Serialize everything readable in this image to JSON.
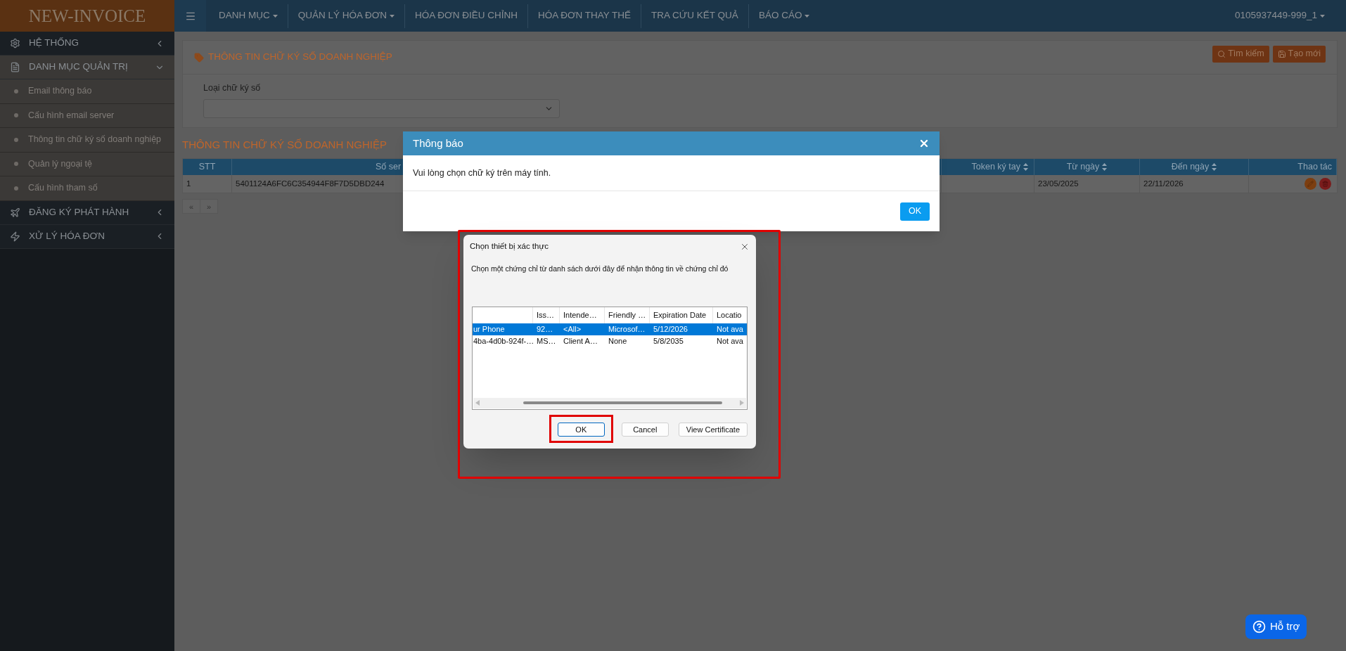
{
  "app": {
    "logo": "NEW-INVOICE"
  },
  "top_nav": {
    "items": [
      {
        "label": "DANH MỤC",
        "dropdown": true
      },
      {
        "label": "QUẢN LÝ HÓA ĐƠN",
        "dropdown": true
      },
      {
        "label": "HÓA ĐƠN ĐIỀU CHỈNH",
        "dropdown": false
      },
      {
        "label": "HÓA ĐƠN THAY THẾ",
        "dropdown": false
      },
      {
        "label": "TRA CỨU KẾT QUẢ",
        "dropdown": false
      },
      {
        "label": "BÁO CÁO",
        "dropdown": true
      }
    ],
    "user": {
      "label": "0105937449-999_1",
      "dropdown": true
    }
  },
  "sidebar": {
    "items": [
      {
        "label": "HỆ THỐNG",
        "expanded": false
      },
      {
        "label": "DANH MỤC QUẢN TRỊ",
        "expanded": true,
        "children": [
          {
            "label": "Email thông báo"
          },
          {
            "label": "Cấu hình email server"
          },
          {
            "label": "Thông tin chữ ký số doanh nghiệp"
          },
          {
            "label": "Quản lý ngoại tệ"
          },
          {
            "label": "Cấu hình tham số"
          }
        ]
      },
      {
        "label": "ĐĂNG KÝ PHÁT HÀNH",
        "expanded": false
      },
      {
        "label": "XỬ LÝ HÓA ĐƠN",
        "expanded": false
      }
    ]
  },
  "panel": {
    "title": "THÔNG TIN CHỮ KÝ SỐ DOANH NGHIỆP",
    "buttons": [
      "Tìm kiếm",
      "Tạo mới"
    ],
    "field_label": "Loại chữ ký số"
  },
  "table": {
    "title": "THÔNG TIN CHỮ KÝ SỐ DOANH NGHIỆP",
    "columns": [
      {
        "label": "STT",
        "sortable": false
      },
      {
        "label": "Số ser"
      },
      {
        "label": "Token ký tay",
        "sortable": true
      },
      {
        "label": "Từ ngày",
        "sortable": true
      },
      {
        "label": "Đến ngày",
        "sortable": true
      },
      {
        "label": "Thao tác",
        "sortable": false
      }
    ],
    "rows": [
      {
        "cells": [
          "1",
          "5401124A6FC6C354944F8F7D5DBD244",
          "",
          "23/05/2025",
          "22/11/2026"
        ]
      }
    ],
    "pager": [
      "«",
      "»"
    ]
  },
  "notice_dialog": {
    "title": "Thông báo",
    "message": "Vui lòng chọn chữ ký trên máy tính.",
    "ok": "OK"
  },
  "cert_dialog": {
    "title": "Chọn thiết bị xác thực",
    "description": "Chọn một chứng chỉ từ danh sách dưới đây để nhận thông tin về chứng chỉ đó",
    "columns": [
      "",
      "Iss…",
      "Intende…",
      "Friendly …",
      "Expiration Date",
      "Locatio"
    ],
    "rows": [
      {
        "selected": true,
        "cells": [
          "ur Phone",
          "92…",
          "<All>",
          "Microsof…",
          "5/12/2026",
          "Not ava"
        ]
      },
      {
        "selected": false,
        "cells": [
          "4ba-4d0b-924f-…",
          "MS…",
          "Client A…",
          "None",
          "5/8/2035",
          "Not ava"
        ]
      }
    ],
    "buttons": [
      {
        "label": "OK",
        "focused": true,
        "highlighted": true
      },
      {
        "label": "Cancel",
        "focused": false,
        "highlighted": false
      },
      {
        "label": "View Certificate",
        "focused": false,
        "highlighted": false
      }
    ],
    "highlighted": true
  },
  "help_button": {
    "label": "Hỗ trợ"
  }
}
